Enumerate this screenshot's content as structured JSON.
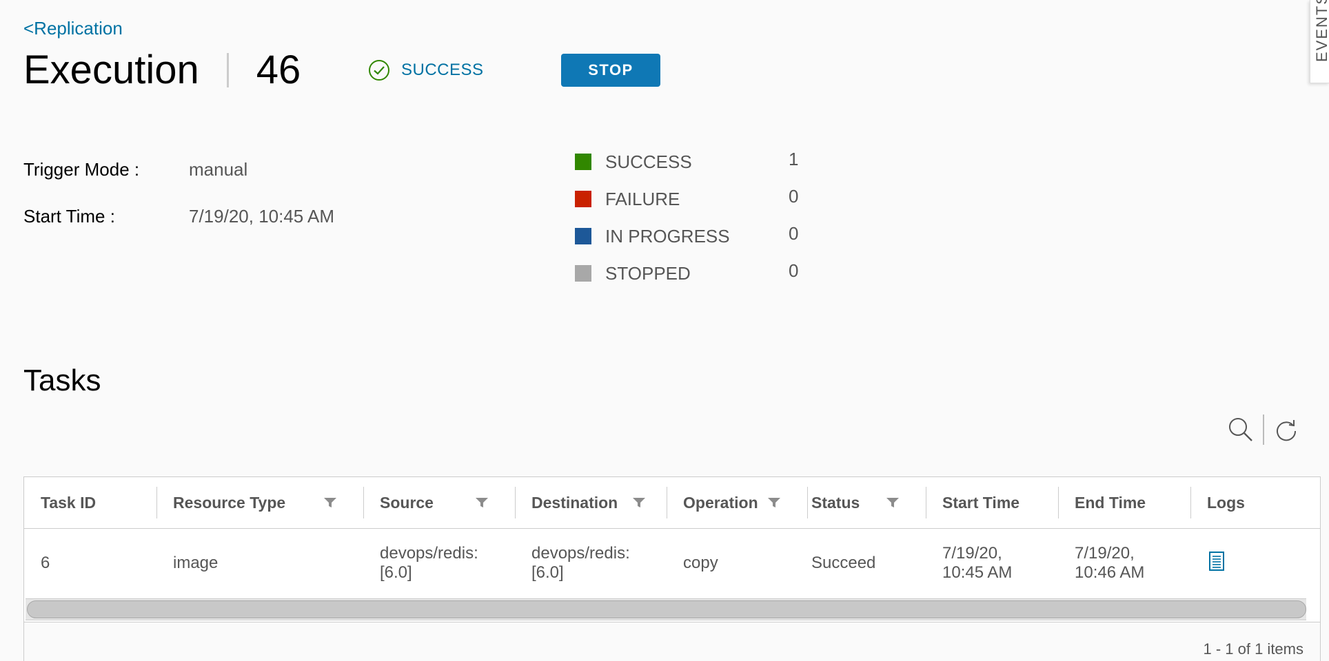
{
  "header": {
    "back_link": "<Replication",
    "title": "Execution",
    "execution_id": "46",
    "status": "SUCCESS",
    "stop_label": "STOP",
    "side_tab": "EVENTS"
  },
  "info": {
    "trigger_mode_label": "Trigger Mode :",
    "trigger_mode_value": "manual",
    "start_time_label": "Start Time :",
    "start_time_value": "7/19/20, 10:45 AM"
  },
  "summary": [
    {
      "label": "SUCCESS",
      "count": "1",
      "color": "#318700"
    },
    {
      "label": "FAILURE",
      "count": "0",
      "color": "#c92100"
    },
    {
      "label": "IN PROGRESS",
      "count": "0",
      "color": "#1d5898"
    },
    {
      "label": "STOPPED",
      "count": "0",
      "color": "#a8a8a8"
    }
  ],
  "tasks": {
    "title": "Tasks",
    "columns": [
      "Task ID",
      "Resource Type",
      "Source",
      "Destination",
      "Operation",
      "Status",
      "Start Time",
      "End Time",
      "Logs"
    ],
    "rows": [
      {
        "task_id": "6",
        "resource_type": "image",
        "source_1": "devops/redis:",
        "source_2": "[6.0]",
        "destination_1": "devops/redis:",
        "destination_2": "[6.0]",
        "operation": "copy",
        "status": "Succeed",
        "start_1": "7/19/20,",
        "start_2": "10:45 AM",
        "end_1": "7/19/20,",
        "end_2": "10:46 AM",
        "logs_icon": "log-document-icon"
      }
    ],
    "footer": "1 - 1 of 1 items"
  },
  "colors": {
    "accent": "#0072a3",
    "button": "#0f78b5"
  }
}
